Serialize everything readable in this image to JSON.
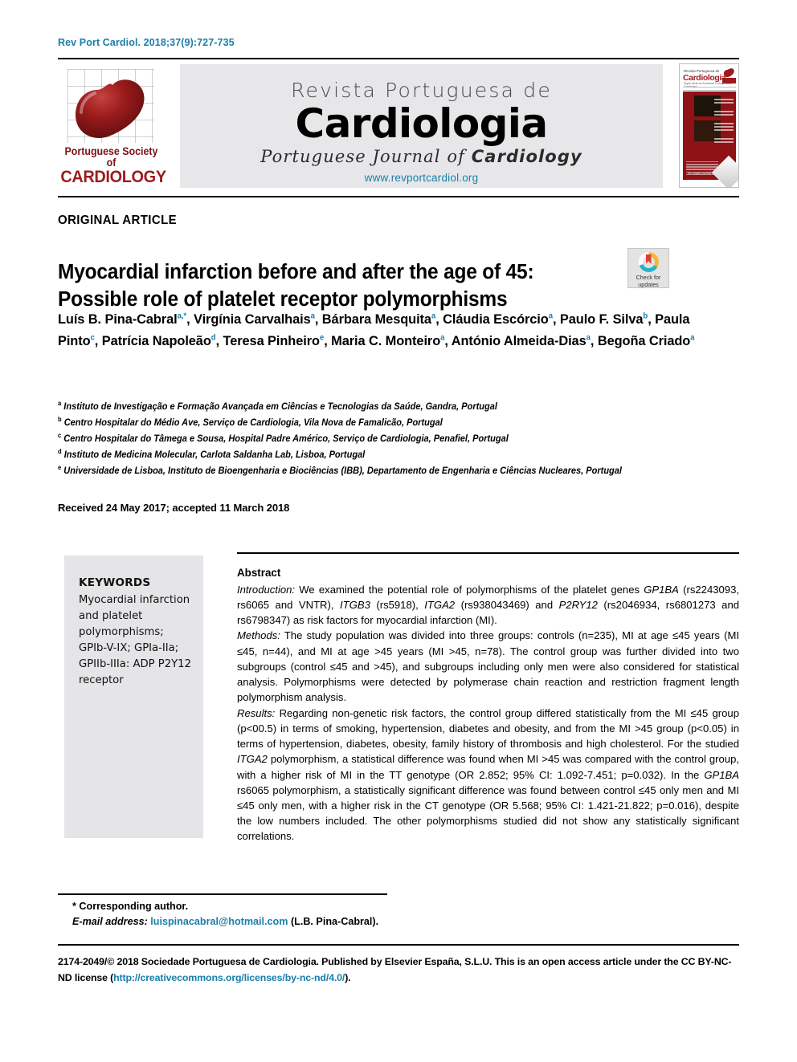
{
  "running_head": "Rev Port Cardiol. 2018;37(9):727-735",
  "masthead": {
    "society_line1": "Portuguese Society of",
    "society_line2": "CARDIOLOGY",
    "journal_pre": "Revista Portuguesa de",
    "journal_main": "Cardiologia",
    "journal_sub_plain": "Portuguese Journal of ",
    "journal_sub_bold": "Cardiology",
    "journal_url": "www.revportcardiol.org",
    "cover": {
      "pre": "Revista Portuguesa de",
      "main": "Cardiologia",
      "sub": "Órgão oficial da Sociedade Portuguesa de Cardiologia",
      "bottom": "An organ journal of Cardiology"
    }
  },
  "article_type": "ORIGINAL ARTICLE",
  "title_line1": "Myocardial infarction before and after the age of 45:",
  "title_line2": "Possible role of platelet receptor polymorphisms",
  "crossmark": {
    "label_line1": "Check for",
    "label_line2": "updates"
  },
  "authors_html": "Luís B. Pina-Cabral<sup>a,*</sup>, Virgínia Carvalhais<sup>a</sup>, Bárbara Mesquita<sup>a</sup>, Cláudia Escórcio<sup>a</sup>, Paulo F. Silva<sup>b</sup>, Paula Pinto<sup>c</sup>, Patrícia Napoleão<sup>d</sup>, Teresa Pinheiro<sup>e</sup>, Maria C. Monteiro<sup>a</sup>, António Almeida-Dias<sup>a</sup>, Begoña Criado<sup>a</sup>",
  "affiliations": [
    {
      "mark": "a",
      "text": "Instituto de Investigação e Formação Avançada em Ciências e Tecnologias da Saúde, Gandra, Portugal"
    },
    {
      "mark": "b",
      "text": "Centro Hospitalar do Médio Ave, Serviço de Cardiologia, Vila Nova de Famalicão, Portugal"
    },
    {
      "mark": "c",
      "text": "Centro Hospitalar do Tâmega e Sousa, Hospital Padre Américo, Serviço de Cardiologia, Penafiel, Portugal"
    },
    {
      "mark": "d",
      "text": "Instituto de Medicina Molecular, Carlota Saldanha Lab, Lisboa, Portugal"
    },
    {
      "mark": "e",
      "text": "Universidade de Lisboa, Instituto de Bioengenharia e Biociências (IBB), Departamento de Engenharia e Ciências Nucleares, Portugal"
    }
  ],
  "received_line": "Received 24 May 2017; accepted 11 March 2018",
  "keywords": {
    "heading": "KEYWORDS",
    "text": "Myocardial infarction and platelet polymorphisms; GPIb-V-IX; GPIa-IIa; GPIIb-IIIa: ADP P2Y12 receptor"
  },
  "abstract": {
    "heading": "Abstract",
    "sections": [
      {
        "label": "Introduction:",
        "body_html": " We examined the potential role of polymorphisms of the platelet genes <i>GP1BA</i> (rs2243093, rs6065 and VNTR), <i>ITGB3</i> (rs5918), <i>ITGA2</i> (rs938043469) and <i>P2RY12</i> (rs2046934, rs6801273 and rs6798347) as risk factors for myocardial infarction (MI)."
      },
      {
        "label": "Methods:",
        "body_html": " The study population was divided into three groups: controls (n=235), MI at age &#8804;45 years (MI &#8804;45, n=44), and MI at age &gt;45 years (MI &gt;45, n=78). The control group was further divided into two subgroups (control &#8804;45 and &gt;45), and subgroups including only men were also considered for statistical analysis. Polymorphisms were detected by polymerase chain reaction and restriction fragment length polymorphism analysis."
      },
      {
        "label": "Results:",
        "body_html": " Regarding non-genetic risk factors, the control group differed statistically from the MI &#8804;45 group (p&lt;00.5) in terms of smoking, hypertension, diabetes and obesity, and from the MI &gt;45 group (p&lt;0.05) in terms of hypertension, diabetes, obesity, family history of thrombosis and high cholesterol. For the studied <i>ITGA2</i> polymorphism, a statistical difference was found when MI &gt;45 was compared with the control group, with a higher risk of MI in the TT genotype (OR 2.852; 95% CI: 1.092-7.451; p=0.032). In the <i>GP1BA</i> rs6065 polymorphism, a statistically significant difference was found between control &#8804;45 only men and MI &#8804;45 only men, with a higher risk in the CT genotype (OR 5.568; 95% CI: 1.421-21.822; p=0.016), despite the low numbers included. The other polymorphisms studied did not show any statistically significant correlations."
      }
    ]
  },
  "footnote": {
    "corresponding": "* Corresponding author.",
    "email_label": "E-mail address:",
    "email": "luispinacabral@hotmail.com",
    "email_owner": "(L.B. Pina-Cabral)."
  },
  "copyright": {
    "text_before": "2174-2049/© 2018 Sociedade Portuguesa de Cardiologia. Published by Elsevier España, S.L.U. This is an open access article under the CC BY-NC-ND license (",
    "license_url": "http://creativecommons.org/licenses/by-nc-nd/4.0/",
    "text_after": ")."
  },
  "colors": {
    "link": "#1a7faa",
    "band": "#e7e7e9",
    "keyword_box": "#e5e5e7",
    "society_red": "#9d1b1f",
    "cover_red": "#8e1216"
  }
}
